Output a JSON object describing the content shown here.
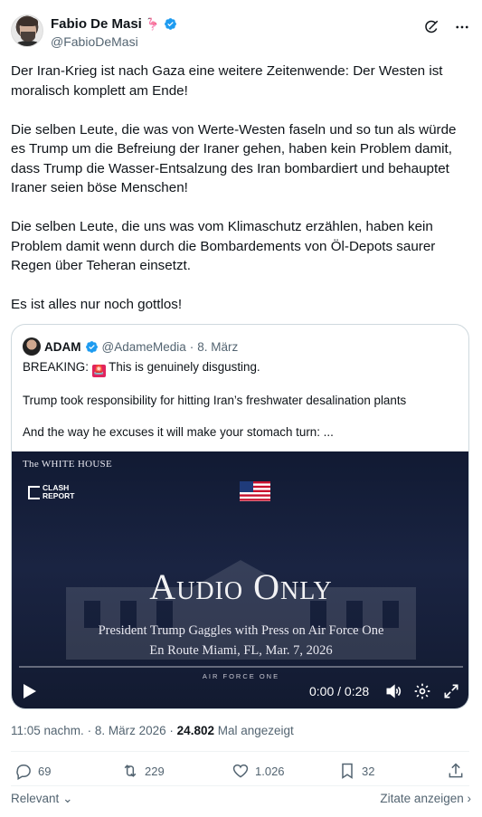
{
  "author": {
    "display_name": "Fabio De Masi",
    "name_emoji": "🦩",
    "handle": "@FabioDeMasi"
  },
  "tweet": {
    "paragraphs": [
      "Der Iran-Krieg ist nach Gaza eine weitere Zeitenwende: Der Westen ist moralisch komplett am Ende!",
      "Die selben Leute, die was von Werte-Westen faseln und so tun als würde es Trump um die Befreiung der Iraner gehen, haben kein Problem damit, dass Trump die Wasser-Entsalzung des Iran bombardiert und behauptet Iraner seien böse Menschen!",
      "Die selben Leute, die uns was vom Klimaschutz erzählen, haben kein Problem damit wenn durch die Bombardements von Öl-Depots saurer Regen über Teheran einsetzt.",
      "Es ist alles nur noch gottlos!"
    ]
  },
  "quote": {
    "display_name": "ADAM",
    "handle": "@AdameMedia",
    "separator": "·",
    "date": "8. März",
    "breaking_label": "BREAKING:",
    "siren_emoji": "🚨",
    "line1_rest": "This is genuinely disgusting.",
    "line2": "Trump took responsibility for hitting Iran’s freshwater desalination plants",
    "line3": "And the way he excuses it will make your stomach turn: ..."
  },
  "video": {
    "watermark": "The WHITE HOUSE",
    "logo_top": "CLASH",
    "logo_bottom": "REPORT",
    "title": "Audio Only",
    "subtitle1": "President Trump Gaggles with Press on Air Force One",
    "subtitle2": "En Route Miami, FL, Mar. 7, 2026",
    "footer_label": "AIR FORCE ONE",
    "time": "0:00 / 0:28",
    "progress": 0
  },
  "meta": {
    "time": "11:05 nachm.",
    "dot": "·",
    "date": "8. März 2026",
    "views": "24.802",
    "views_label": "Mal angezeigt"
  },
  "actions": {
    "replies": "69",
    "reposts": "229",
    "likes": "1.026",
    "bookmarks": "32"
  },
  "footer": {
    "sort_label": "Relevant",
    "quotes_label": "Zitate anzeigen"
  },
  "colors": {
    "verified": "#1d9bf0",
    "secondary_text": "#536471",
    "video_bg": "#141c36"
  }
}
